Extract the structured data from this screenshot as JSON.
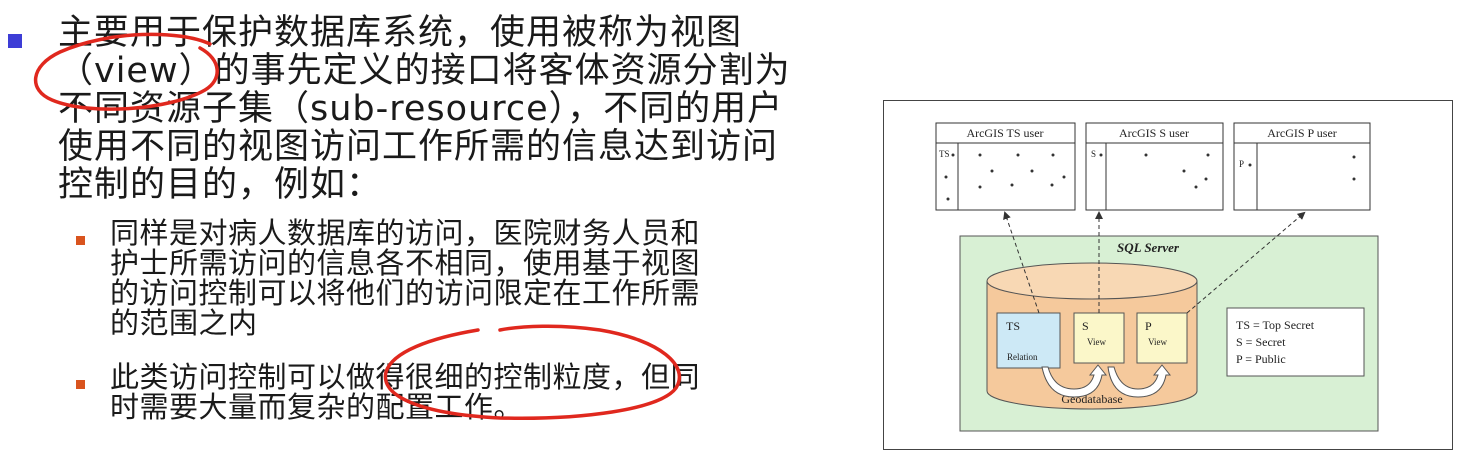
{
  "main_bullet": {
    "lines": [
      "主要用于保护数据库系统，使用被称为视图",
      "（view）的事先定义的接口将客体资源分割为",
      "不同资源子集（sub-resource），不同的用户",
      "使用不同的视图访问工作所需的信息达到访问",
      "控制的目的，例如："
    ]
  },
  "sub_bullets": [
    {
      "lines": [
        "同样是对病人数据库的访问，医院财务人员和",
        "护士所需访问的信息各不相同，使用基于视图",
        "的访问控制可以将他们的访问限定在工作所需",
        "的范围之内"
      ]
    },
    {
      "lines": [
        "此类访问控制可以做得很细的控制粒度，但同",
        "时需要大量而复杂的配置工作。"
      ]
    }
  ],
  "colors": {
    "level1_bullet": "#3d3dd6",
    "level2_bullet": "#d9541e",
    "annotation_ink": "#e0281e",
    "sql_server_fill": "#d8f0d4",
    "geodatabase_fill": "#f5c99c",
    "ts_fill": "#cde9f6",
    "view_fill": "#fbf7c9"
  },
  "diagram": {
    "users": [
      {
        "title": "ArcGIS TS user",
        "tag": "TS"
      },
      {
        "title": "ArcGIS S user",
        "tag": "S"
      },
      {
        "title": "ArcGIS P user",
        "tag": "P"
      }
    ],
    "sql_server_label": "SQL Server",
    "geodatabase_label": "Geodatabase",
    "tables": [
      {
        "name": "TS",
        "sub": "Relation"
      },
      {
        "name": "S",
        "sub": "View"
      },
      {
        "name": "P",
        "sub": "View"
      }
    ],
    "legend": [
      "TS = Top Secret",
      "S = Secret",
      "P = Public"
    ]
  }
}
